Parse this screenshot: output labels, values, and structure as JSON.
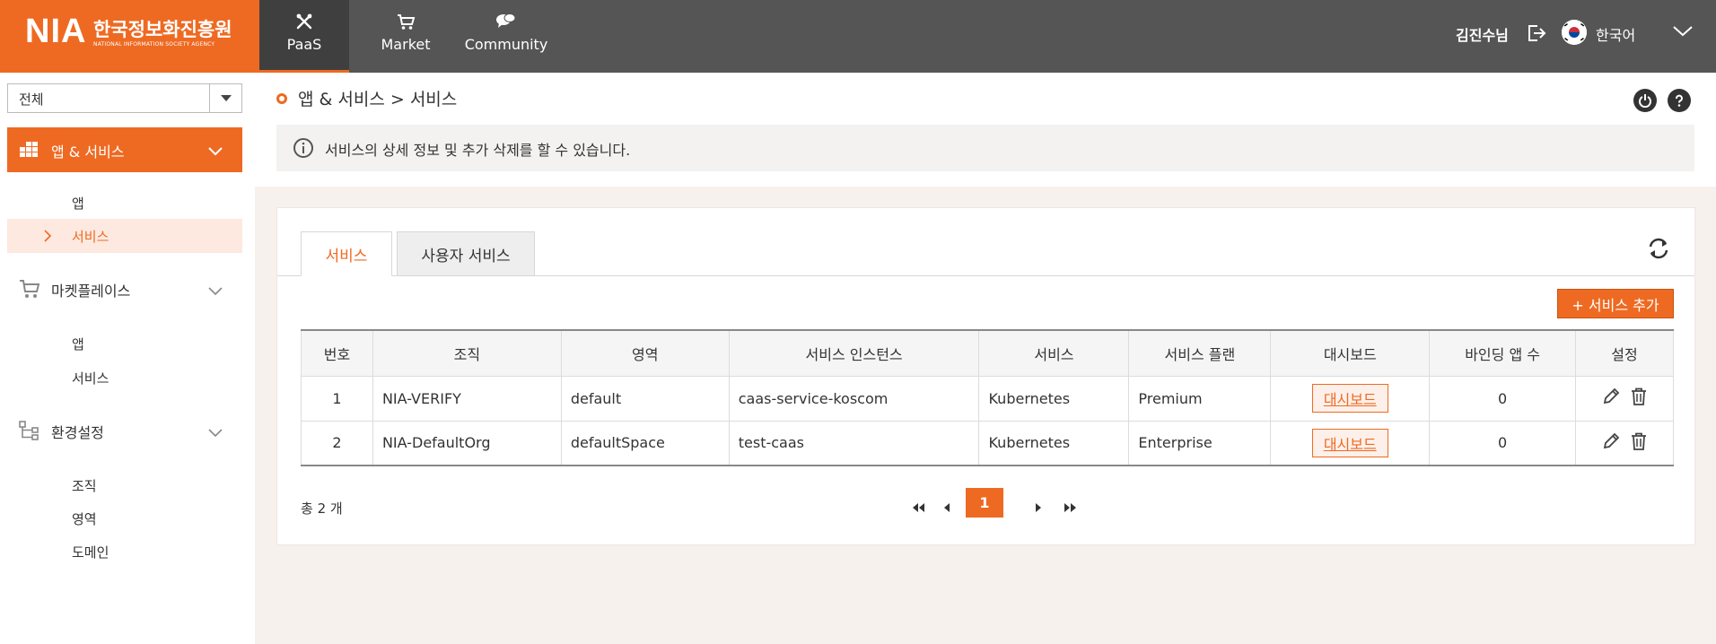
{
  "header": {
    "logo_nia": "NIA",
    "logo_kr": "한국정보화진흥원",
    "logo_en": "NATIONAL INFORMATION SOCIETY AGENCY",
    "nav": [
      {
        "label": "PaaS",
        "icon": "tools-icon"
      },
      {
        "label": "Market",
        "icon": "cart-icon"
      },
      {
        "label": "Community",
        "icon": "chat-icon"
      }
    ],
    "user": "김진수님",
    "language": "한국어"
  },
  "sidebar": {
    "select_value": "전체",
    "menu_active": "앱 & 서비스",
    "menu_active_items": [
      "앱",
      "서비스"
    ],
    "marketplace": "마켓플레이스",
    "marketplace_items": [
      "앱",
      "서비스"
    ],
    "settings": "환경설정",
    "settings_items": [
      "조직",
      "영역",
      "도메인"
    ]
  },
  "breadcrumb": "앱 & 서비스 > 서비스",
  "info_text": "서비스의 상세 정보 및 추가 삭제를 할 수 있습니다.",
  "tabs": [
    "서비스",
    "사용자 서비스"
  ],
  "add_button": "+ 서비스 추가",
  "table": {
    "headers": [
      "번호",
      "조직",
      "영역",
      "서비스 인스턴스",
      "서비스",
      "서비스 플랜",
      "대시보드",
      "바인딩 앱 수",
      "설정"
    ],
    "rows": [
      {
        "no": "1",
        "org": "NIA-VERIFY",
        "space": "default",
        "instance": "caas-service-koscom",
        "service": "Kubernetes",
        "plan": "Premium",
        "dashboard": "대시보드",
        "bound": "0"
      },
      {
        "no": "2",
        "org": "NIA-DefaultOrg",
        "space": "defaultSpace",
        "instance": "test-caas",
        "service": "Kubernetes",
        "plan": "Enterprise",
        "dashboard": "대시보드",
        "bound": "0"
      }
    ]
  },
  "total": "총 2 개",
  "pagination": {
    "current": "1"
  },
  "colors": {
    "accent": "#ee6a22",
    "header_bg": "#555555"
  }
}
